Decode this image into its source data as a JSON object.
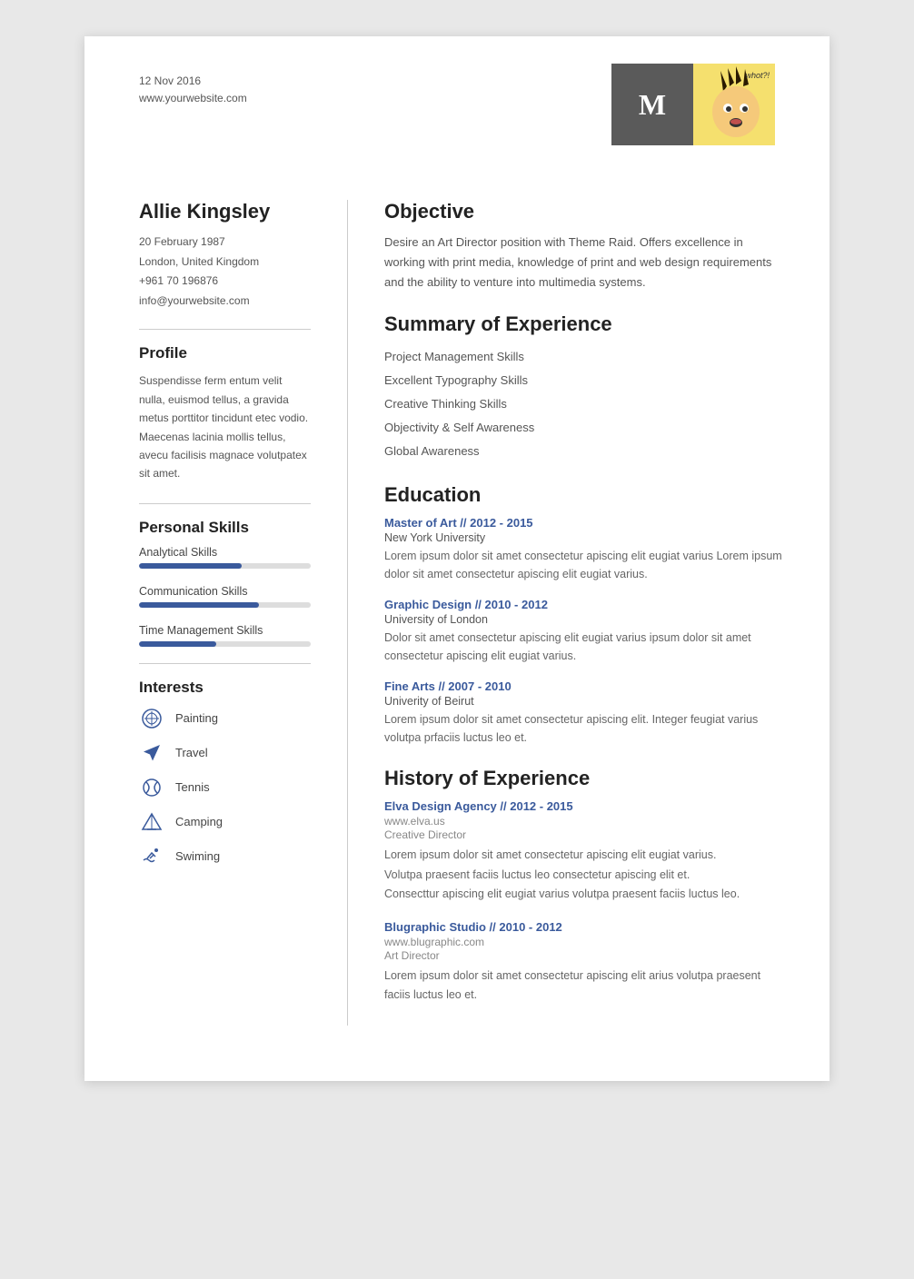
{
  "header": {
    "date": "12 Nov 2016",
    "website": "www.yourwebsite.com",
    "initial": "M",
    "whot": "whot?!"
  },
  "person": {
    "name": "Allie Kingsley",
    "dob": "20 February 1987",
    "location": "London, United Kingdom",
    "phone": "+961 70 196876",
    "email": "info@yourwebsite.com"
  },
  "profile": {
    "title": "Profile",
    "text": "Suspendisse ferm entum velit nulla, euismod tellus, a gravida metus porttitor tincidunt etec vodio. Maecenas lacinia mollis tellus, avecu facilisis magnace volutpatex sit amet."
  },
  "personal_skills": {
    "title": "Personal Skills",
    "skills": [
      {
        "label": "Analytical Skills",
        "percent": 60
      },
      {
        "label": "Communication Skills",
        "percent": 70
      },
      {
        "label": "Time Management Skills",
        "percent": 45
      }
    ]
  },
  "interests": {
    "title": "Interests",
    "items": [
      {
        "icon": "🎨",
        "label": "Painting"
      },
      {
        "icon": "✈",
        "label": "Travel"
      },
      {
        "icon": "🎾",
        "label": "Tennis"
      },
      {
        "icon": "⛺",
        "label": "Camping"
      },
      {
        "icon": "🏊",
        "label": "Swiming"
      }
    ]
  },
  "objective": {
    "title": "Objective",
    "text": "Desire an Art Director position with Theme Raid. Offers excellence in working with print media, knowledge of print and web design requirements and the ability to venture into multimedia systems."
  },
  "summary": {
    "title": "Summary of Experience",
    "items": [
      "Project Management Skills",
      "Excellent Typography Skills",
      "Creative Thinking Skills",
      "Objectivity & Self Awareness",
      "Global Awareness"
    ]
  },
  "education": {
    "title": "Education",
    "items": [
      {
        "degree": "Master of Art // 2012 - 2015",
        "school": "New York University",
        "desc": "Lorem ipsum dolor sit amet consectetur apiscing elit eugiat varius Lorem ipsum dolor sit amet consectetur apiscing elit eugiat varius."
      },
      {
        "degree": "Graphic Design // 2010 - 2012",
        "school": "University of London",
        "desc": "Dolor sit amet consectetur apiscing elit eugiat varius  ipsum dolor sit amet consectetur apiscing elit eugiat varius."
      },
      {
        "degree": "Fine Arts // 2007 - 2010",
        "school": "Univerity of Beirut",
        "desc": "Lorem ipsum dolor sit amet consectetur apiscing elit. Integer feugiat varius volutpa prfaciis luctus leo et."
      }
    ]
  },
  "history": {
    "title": "History of Experience",
    "items": [
      {
        "title": "Elva Design Agency // 2012 - 2015",
        "url": "www.elva.us",
        "role": "Creative Director",
        "desc": "Lorem ipsum dolor sit amet consectetur apiscing elit eugiat varius.\nVolutpa praesent faciis luctus leo consectetur apiscing elit et.\nConsecttur apiscing elit eugiat varius volutpa praesent faciis luctus leo."
      },
      {
        "title": "Blugraphic Studio // 2010 - 2012",
        "url": "www.blugraphic.com",
        "role": "Art Director",
        "desc": "Lorem ipsum dolor sit amet consectetur apiscing elit arius volutpa praesent faciis luctus leo et."
      }
    ]
  }
}
